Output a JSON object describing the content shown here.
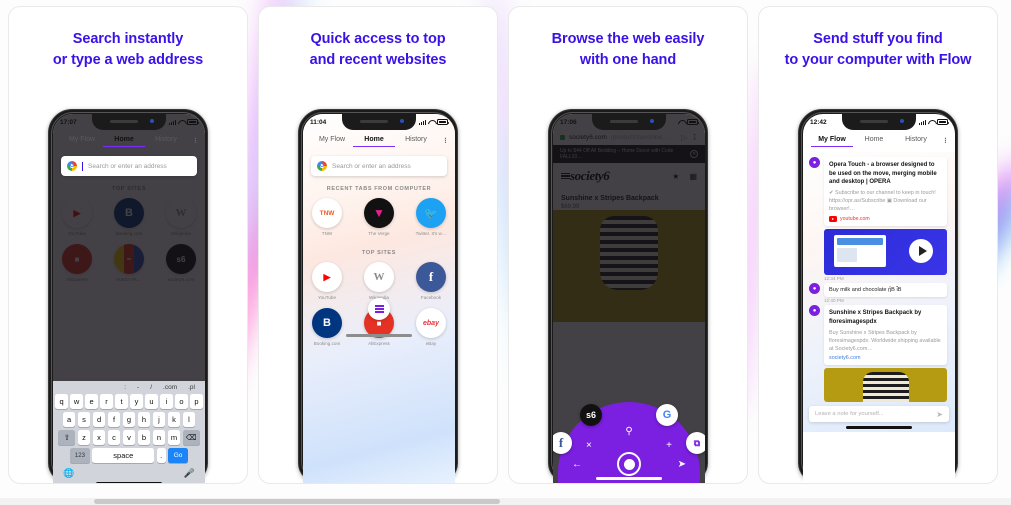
{
  "theme": {
    "headline_color": "#3a12e8",
    "accent_purple": "#7b1fe0",
    "blue": "#1b84f7"
  },
  "panels": [
    {
      "headline": [
        "Search instantly",
        "or type a web address"
      ],
      "phone": {
        "time": "17:07",
        "tabs": [
          "My Flow",
          "Home",
          "History"
        ],
        "active_tab": "Home",
        "search_placeholder": "Search or enter an address",
        "section_title": "TOP SITES",
        "tiles": [
          {
            "label": "YouTube",
            "glyph": "▶"
          },
          {
            "label": "Booking.com",
            "glyph": "B"
          },
          {
            "label": "Wikipedia",
            "glyph": "W"
          },
          {
            "label": "AliExpress",
            "glyph": "■"
          },
          {
            "label": "AUKEY.PL…",
            "glyph": "━"
          },
          {
            "label": "society6.com",
            "glyph": "s6"
          }
        ],
        "keyboard": {
          "suggestions": [
            ":",
            "-",
            "/",
            ".com",
            ".pl"
          ],
          "row1": [
            "q",
            "w",
            "e",
            "r",
            "t",
            "y",
            "u",
            "i",
            "o",
            "p"
          ],
          "row2": [
            "a",
            "s",
            "d",
            "f",
            "g",
            "h",
            "j",
            "k",
            "l"
          ],
          "row3": [
            "z",
            "x",
            "c",
            "v",
            "b",
            "n",
            "m"
          ],
          "shift": "⇧",
          "backspace": "⌫",
          "numbers": "123",
          "space": "space",
          "period": ".",
          "go": "Go",
          "globe": "ἱ0",
          "mic": "Ἲ4"
        }
      }
    },
    {
      "headline": [
        "Quick access to top",
        "and recent websites"
      ],
      "phone": {
        "time": "11:04",
        "tabs": [
          "My Flow",
          "Home",
          "History"
        ],
        "active_tab": "Home",
        "search_placeholder": "Search or enter an address",
        "recent_title": "RECENT TABS FROM COMPUTER",
        "recent": [
          {
            "label": "TNW",
            "glyph": "TNW"
          },
          {
            "label": "The Verge",
            "glyph": "▼"
          },
          {
            "label": "Twitter. It's w…",
            "glyph": "ὂ6"
          }
        ],
        "section_title": "TOP SITES",
        "tiles": [
          {
            "label": "YouTube",
            "glyph": "▶"
          },
          {
            "label": "Wikipedia",
            "glyph": "W"
          },
          {
            "label": "Facebook",
            "glyph": "f"
          },
          {
            "label": "Booking.com",
            "glyph": "B"
          },
          {
            "label": "AliExpress",
            "glyph": "■"
          },
          {
            "label": "eBay",
            "glyph": "ebay"
          }
        ]
      }
    },
    {
      "headline": [
        "Browse the web easily",
        "with one hand"
      ],
      "phone": {
        "time": "17:06",
        "url": "society6.com",
        "url_rest": "/product/sunshine…",
        "promo": "Up to $44 Off All Bedding – Home Decor with Code FALL20…",
        "site_logo": "society6",
        "product_title": "Sunshine x Stripes Backpack",
        "product_price": "$69.99",
        "fan_icons": [
          {
            "name": "facebook-shortcut",
            "glyph": "f"
          },
          {
            "name": "society6-shortcut",
            "glyph": "s6"
          },
          {
            "name": "google-shortcut",
            "glyph": "G"
          },
          {
            "name": "flow-shortcut",
            "glyph": "⧉"
          }
        ],
        "controls": {
          "search": "ὐD",
          "close": "×",
          "add": "+",
          "back": "←",
          "send": "➤"
        }
      }
    },
    {
      "headline": [
        "Send stuff you find",
        "to your computer with Flow"
      ],
      "phone": {
        "time": "12:42",
        "tabs": [
          "My Flow",
          "Home",
          "History"
        ],
        "active_tab": "My Flow",
        "messages": [
          {
            "title": "Opera Touch - a browser designed to be used on the move, merging mobile and desktop | OPERA",
            "sub": "✔ Subscribe to our channel to keep in touch! https://opr.as/Subscribe ▣ Download our browser!…",
            "source": "youtube.com",
            "time": "12:34 PM",
            "type": "video"
          },
          {
            "title": "Buy milk and chocolate ᾕB ἶB",
            "time": "12:40 PM",
            "type": "note"
          },
          {
            "title": "Sunshine x Stripes Backpack by floresimagespdx",
            "sub": "Buy Sunshine x Stripes Backpack by floresimagespdx. Worldwide shipping available at Society6.com…",
            "link": "society6.com",
            "type": "link"
          }
        ],
        "note_placeholder": "Leave a note for yourself..."
      }
    }
  ]
}
